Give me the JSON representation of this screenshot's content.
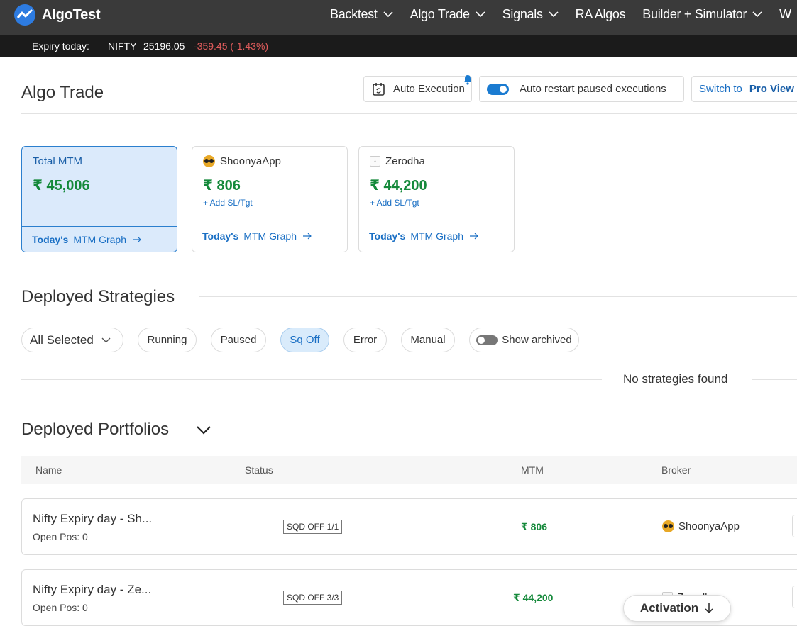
{
  "app": {
    "name": "AlgoTest"
  },
  "nav": {
    "items": [
      {
        "label": "Backtest",
        "dropdown": true
      },
      {
        "label": "Algo Trade",
        "dropdown": true
      },
      {
        "label": "Signals",
        "dropdown": true
      },
      {
        "label": "RA Algos",
        "dropdown": false
      },
      {
        "label": "Builder + Simulator",
        "dropdown": true
      },
      {
        "label": "W",
        "dropdown": false
      }
    ]
  },
  "ticker": {
    "label": "Expiry today:",
    "symbol": "NIFTY",
    "price": "25196.05",
    "change": "-359.45 (-1.43%)",
    "change_color": "#e05c5c"
  },
  "header": {
    "title": "Algo Trade",
    "auto_execution_label": "Auto Execution",
    "auto_restart_label": "Auto restart paused executions",
    "auto_restart_enabled": true,
    "switch_to_label": "Switch to",
    "pro_view_label": "Pro View"
  },
  "mtm_cards": [
    {
      "label": "Total MTM",
      "value": "₹ 45,006",
      "add_sl": "",
      "foot_bold": "Today's",
      "foot_link": "MTM Graph",
      "icon": ""
    },
    {
      "label": "ShoonyaApp",
      "value": "₹ 806",
      "add_sl": "+ Add SL/Tgt",
      "foot_bold": "Today's",
      "foot_link": "MTM Graph",
      "icon": "shoonya-icon"
    },
    {
      "label": "Zerodha",
      "value": "₹ 44,200",
      "add_sl": "+ Add SL/Tgt",
      "foot_bold": "Today's",
      "foot_link": "MTM Graph",
      "icon": "zerodha-icon"
    }
  ],
  "strategies": {
    "title": "Deployed Strategies",
    "filter_select": "All Selected",
    "filters": [
      "Running",
      "Paused",
      "Sq Off",
      "Error",
      "Manual"
    ],
    "active_filter": "Sq Off",
    "show_archived_label": "Show archived",
    "show_archived": false,
    "empty_message": "No strategies found"
  },
  "portfolios": {
    "title": "Deployed Portfolios",
    "columns": [
      "Name",
      "Status",
      "MTM",
      "Broker"
    ],
    "rows": [
      {
        "name": "Nifty Expiry day - Sh...",
        "open_pos": "Open Pos: 0",
        "status": "SQD OFF 1/1",
        "mtm": "₹ 806",
        "broker": "ShoonyaApp"
      },
      {
        "name": "Nifty Expiry day - Ze...",
        "open_pos": "Open Pos: 0",
        "status": "SQD OFF 3/3",
        "mtm": "₹ 44,200",
        "broker": "Zerodha"
      }
    ]
  },
  "activation": {
    "label": "Activation"
  },
  "colors": {
    "brand_blue": "#1a6fc4",
    "profit_green": "#14893a",
    "nav_bg": "#3a3a3a"
  }
}
